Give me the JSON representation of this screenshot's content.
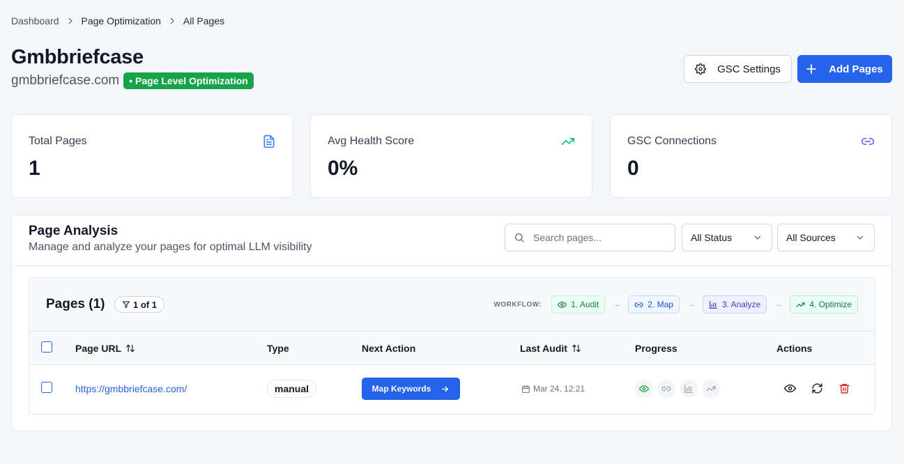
{
  "breadcrumb": {
    "items": [
      "Dashboard",
      "Page Optimization",
      "All Pages"
    ]
  },
  "header": {
    "title": "Gmbbriefcase",
    "domain": "gmbbriefcase.com",
    "badge": "• Page Level Optimization",
    "gsc_button": "GSC Settings",
    "add_button": "Add Pages"
  },
  "stats": [
    {
      "label": "Total Pages",
      "value": "1",
      "icon": "document-icon"
    },
    {
      "label": "Avg Health Score",
      "value": "0%",
      "icon": "trending-up-icon"
    },
    {
      "label": "GSC Connections",
      "value": "0",
      "icon": "link-icon"
    }
  ],
  "panel": {
    "title": "Page Analysis",
    "subtitle": "Manage and analyze your pages for optimal LLM visibility",
    "search_placeholder": "Search pages...",
    "status_select": "All Status",
    "sources_select": "All Sources"
  },
  "pages": {
    "title": "Pages (1)",
    "count_pill": "1 of 1",
    "workflow_label": "WORKFLOW:",
    "workflow_steps": [
      "1. Audit",
      "2. Map",
      "3. Analyze",
      "4. Optimize"
    ],
    "columns": [
      "Page URL",
      "Type",
      "Next Action",
      "Last Audit",
      "Progress",
      "Actions"
    ],
    "rows": [
      {
        "url": "https://gmbbriefcase.com/",
        "type": "manual",
        "next_action": "Map Keywords",
        "last_audit": "Mar 24, 12:21",
        "progress_completed": 1,
        "progress_total": 4
      }
    ]
  },
  "colors": {
    "primary": "#2563eb",
    "success": "#16a34a",
    "background": "#f4f6fa",
    "danger": "#dc2626"
  }
}
